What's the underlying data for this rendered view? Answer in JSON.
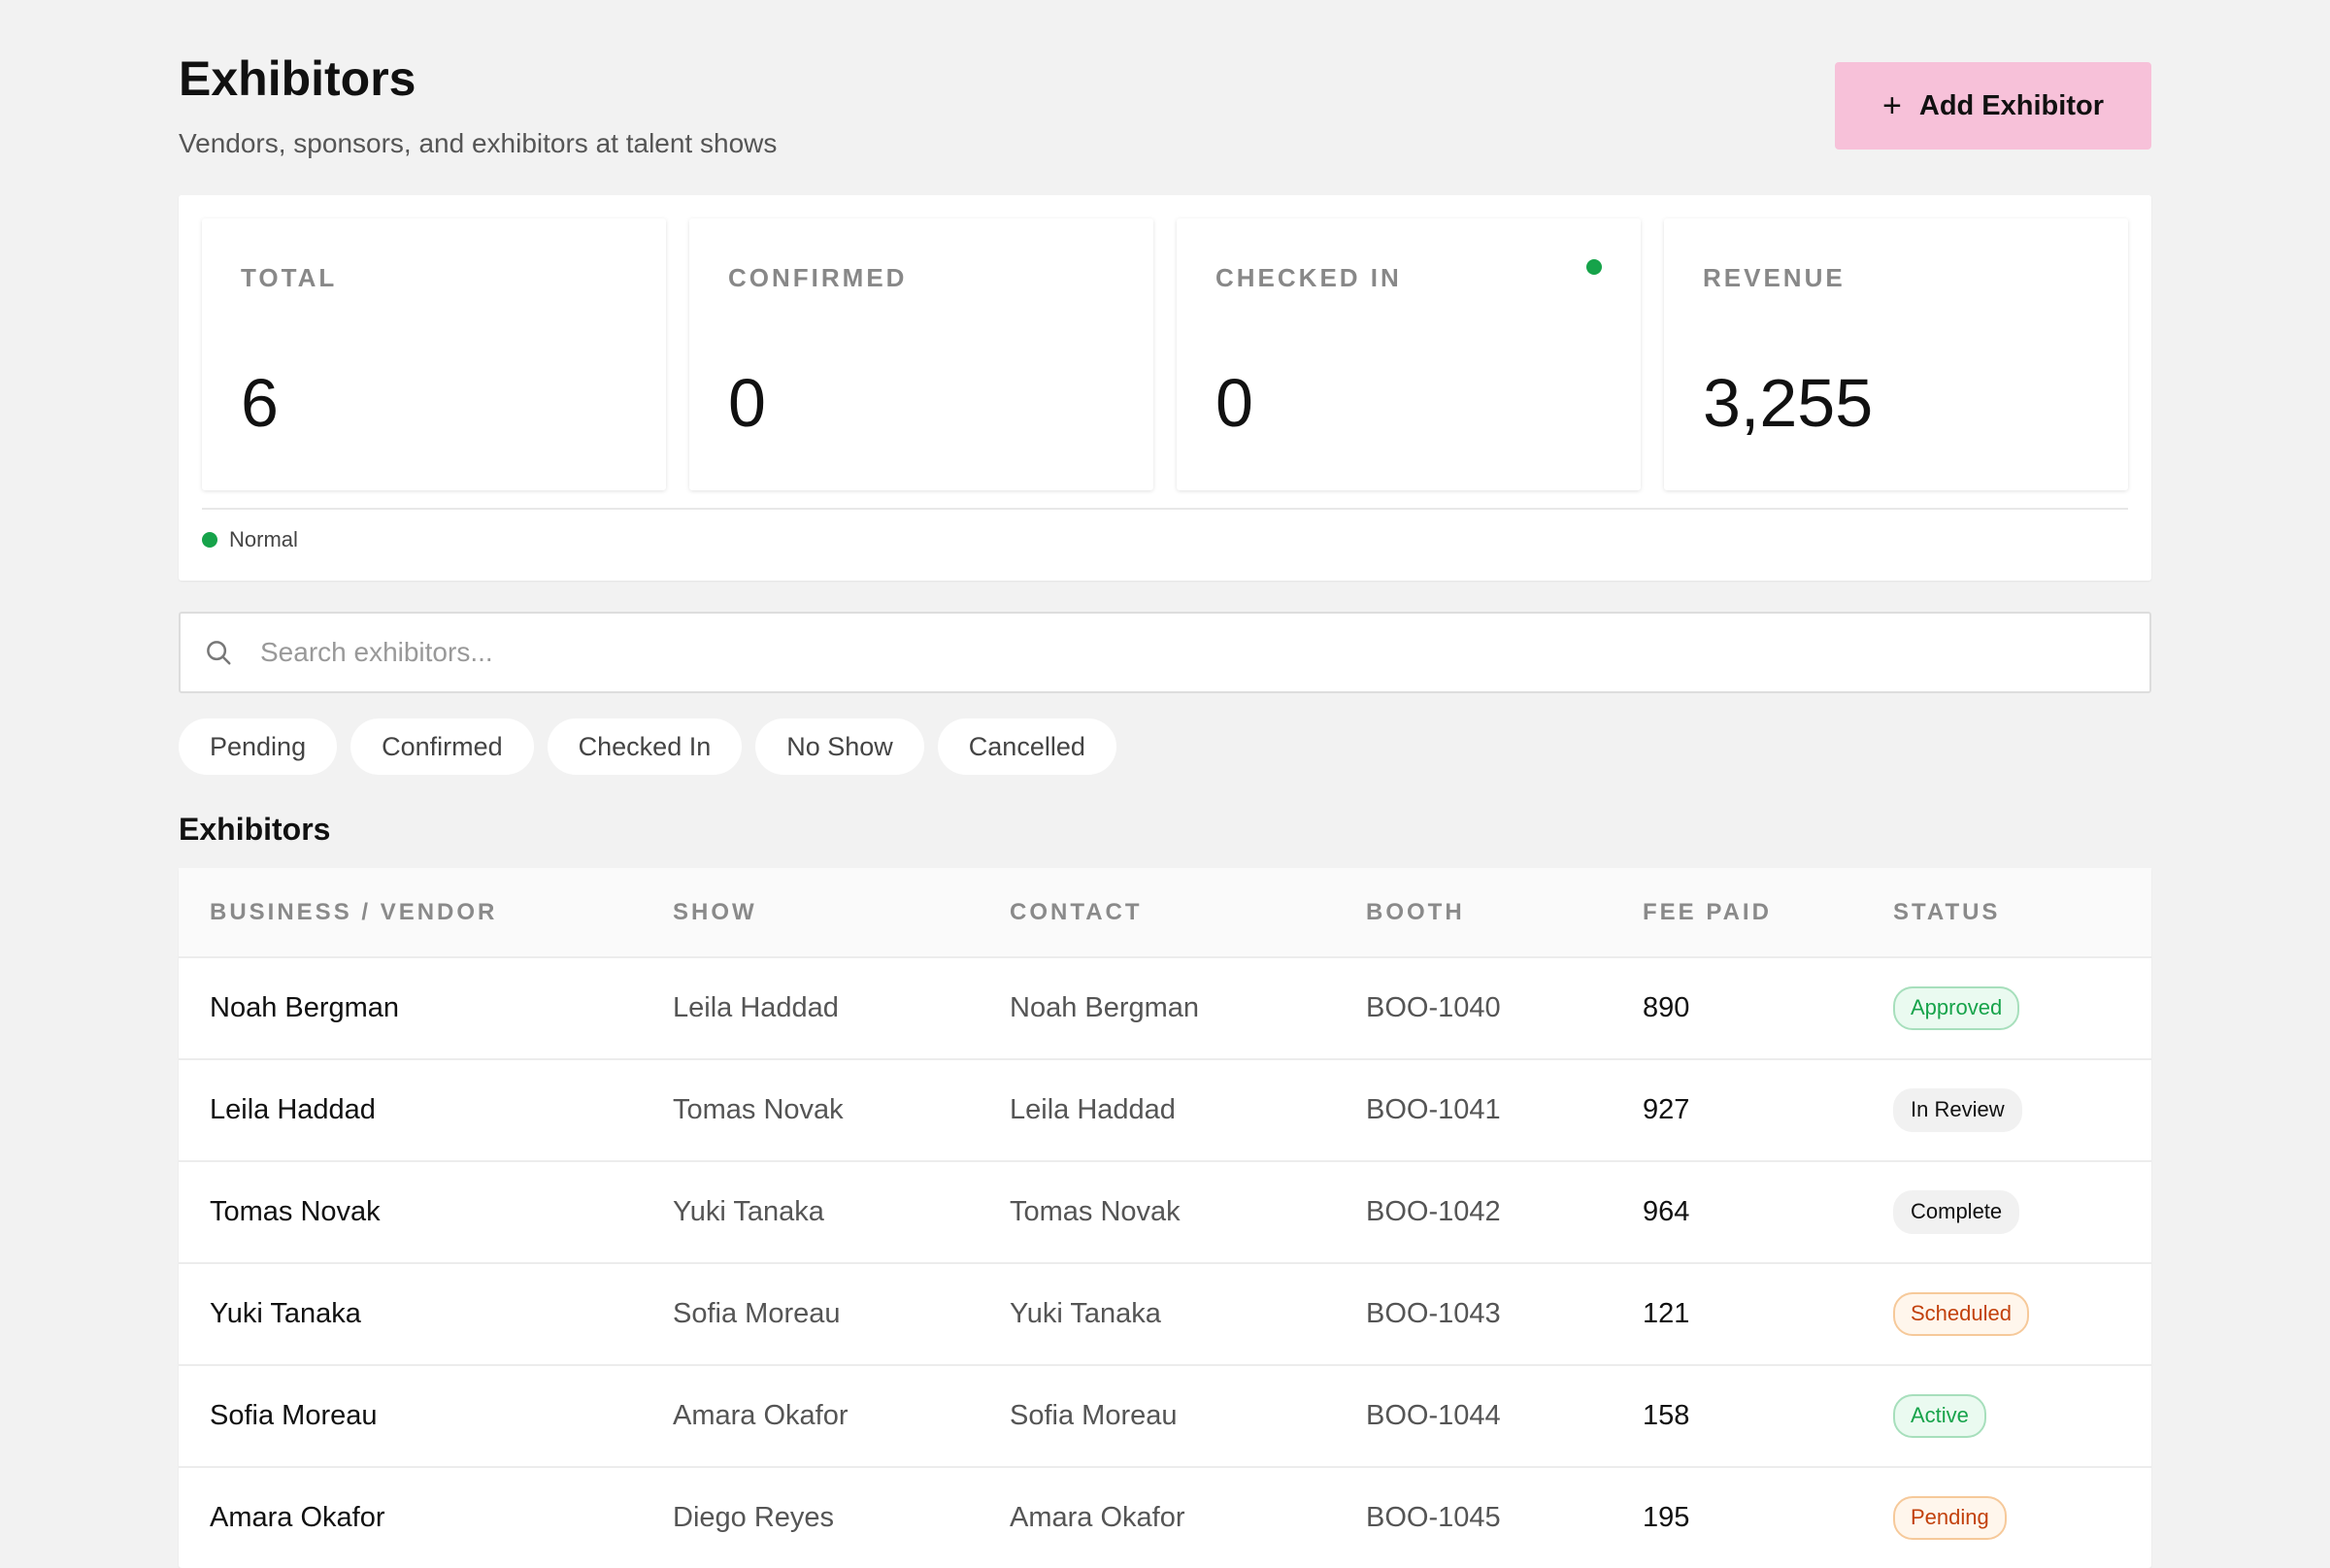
{
  "header": {
    "title": "Exhibitors",
    "subtitle": "Vendors, sponsors, and exhibitors at talent shows",
    "add_button_label": "Add Exhibitor",
    "add_button_color": "#f7c1d9"
  },
  "stats": {
    "total": {
      "label": "TOTAL",
      "value": "6"
    },
    "confirmed": {
      "label": "CONFIRMED",
      "value": "0"
    },
    "checked_in": {
      "label": "CHECKED IN",
      "value": "0"
    },
    "revenue": {
      "label": "REVENUE",
      "value": "3,255"
    },
    "status_text": "Normal",
    "status_color": "#16a34a"
  },
  "search": {
    "placeholder": "Search exhibitors...",
    "value": ""
  },
  "filters": [
    "Pending",
    "Confirmed",
    "Checked In",
    "No Show",
    "Cancelled"
  ],
  "table": {
    "section_title": "Exhibitors",
    "columns": [
      "BUSINESS / VENDOR",
      "SHOW",
      "CONTACT",
      "BOOTH",
      "FEE PAID",
      "STATUS"
    ],
    "rows": [
      {
        "vendor": "Noah Bergman",
        "show": "Leila Haddad",
        "contact": "Noah Bergman",
        "booth": "BOO-1040",
        "fee": "890",
        "status": "Approved",
        "status_style": "approved"
      },
      {
        "vendor": "Leila Haddad",
        "show": "Tomas Novak",
        "contact": "Leila Haddad",
        "booth": "BOO-1041",
        "fee": "927",
        "status": "In Review",
        "status_style": "neutral"
      },
      {
        "vendor": "Tomas Novak",
        "show": "Yuki Tanaka",
        "contact": "Tomas Novak",
        "booth": "BOO-1042",
        "fee": "964",
        "status": "Complete",
        "status_style": "neutral"
      },
      {
        "vendor": "Yuki Tanaka",
        "show": "Sofia Moreau",
        "contact": "Yuki Tanaka",
        "booth": "BOO-1043",
        "fee": "121",
        "status": "Scheduled",
        "status_style": "warm"
      },
      {
        "vendor": "Sofia Moreau",
        "show": "Amara Okafor",
        "contact": "Sofia Moreau",
        "booth": "BOO-1044",
        "fee": "158",
        "status": "Active",
        "status_style": "active"
      },
      {
        "vendor": "Amara Okafor",
        "show": "Diego Reyes",
        "contact": "Amara Okafor",
        "booth": "BOO-1045",
        "fee": "195",
        "status": "Pending",
        "status_style": "warm"
      }
    ]
  }
}
